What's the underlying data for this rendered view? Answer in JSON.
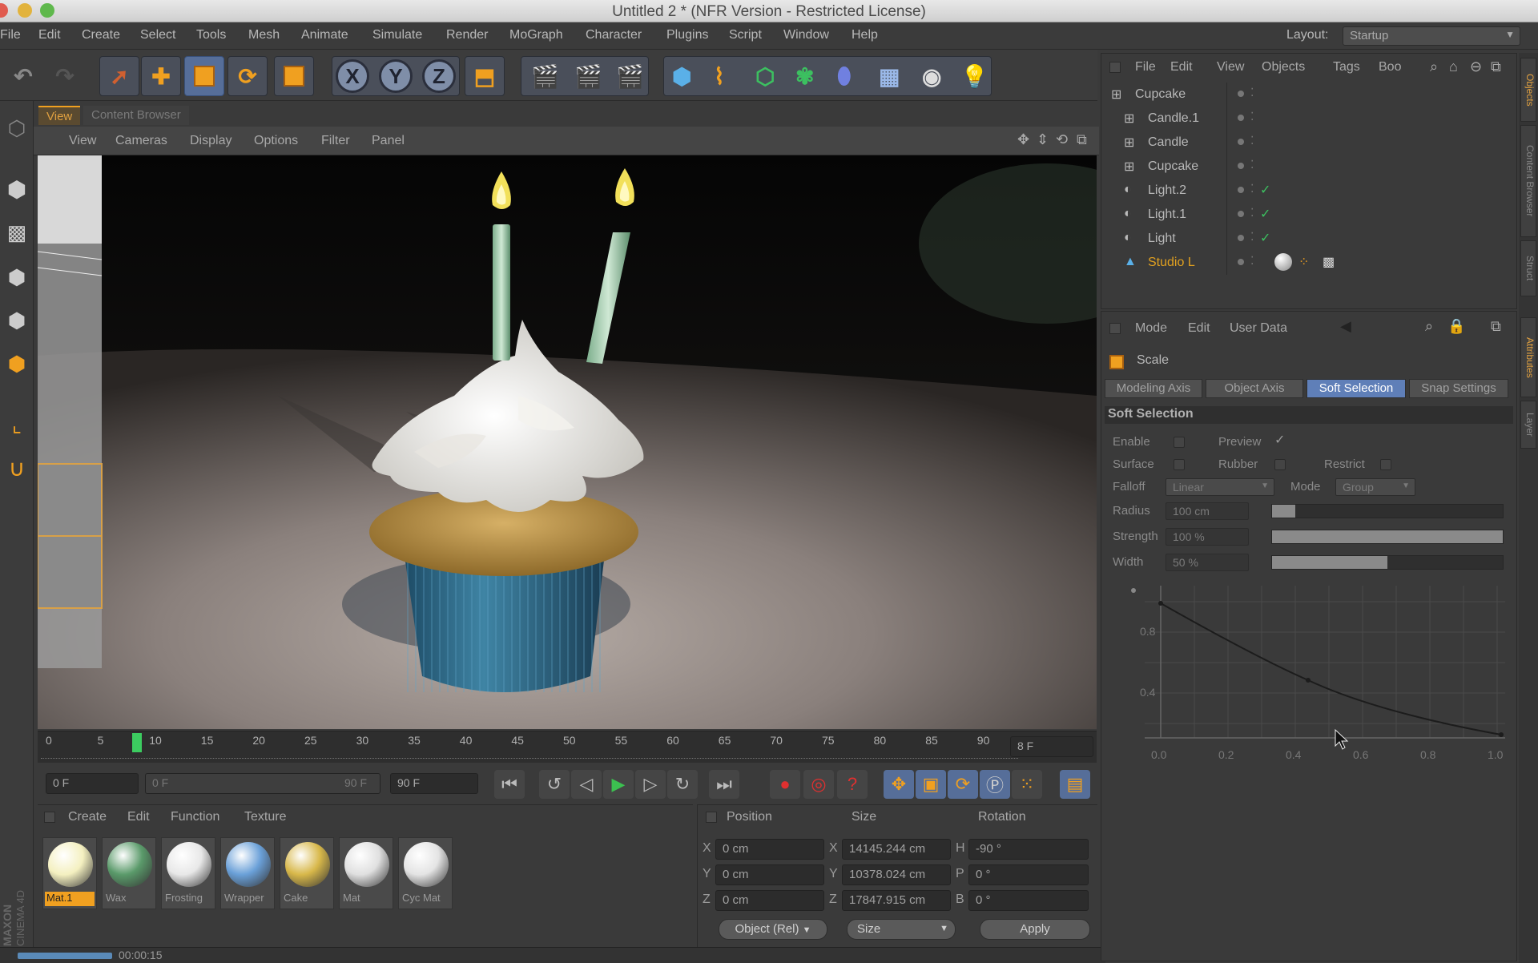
{
  "window": {
    "title": "Untitled 2 * (NFR Version - Restricted License)"
  },
  "menubar": {
    "items": [
      "File",
      "Edit",
      "Create",
      "Select",
      "Tools",
      "Mesh",
      "Animate",
      "Simulate",
      "Render",
      "MoGraph",
      "Character",
      "Plugins",
      "Script",
      "Window",
      "Help"
    ],
    "layout_label": "Layout:",
    "layout_value": "Startup"
  },
  "toolbar": {
    "axis_x": "X",
    "axis_y": "Y",
    "axis_z": "Z"
  },
  "viewport": {
    "tabs": [
      "View",
      "Content Browser"
    ],
    "menu": [
      "View",
      "Cameras",
      "Display",
      "Options",
      "Filter",
      "Panel"
    ]
  },
  "timeline": {
    "ticks": [
      "0",
      "5",
      "10",
      "15",
      "20",
      "25",
      "30",
      "35",
      "40",
      "45",
      "50",
      "55",
      "60",
      "65",
      "70",
      "75",
      "80",
      "85",
      "90"
    ],
    "current_frame": "8 F",
    "start_field": "0 F",
    "range_start": "0 F",
    "range_end": "90 F",
    "end_field": "90 F"
  },
  "materials": {
    "menu": [
      "Create",
      "Edit",
      "Function",
      "Texture"
    ],
    "items": [
      {
        "name": "Mat.1"
      },
      {
        "name": "Wax"
      },
      {
        "name": "Frosting"
      },
      {
        "name": "Wrapper"
      },
      {
        "name": "Cake"
      },
      {
        "name": "Mat"
      },
      {
        "name": "Cyc Mat"
      }
    ],
    "colors": [
      "#f4f0c0",
      "#5a9a6a",
      "#e8e8e8",
      "#6aa0d8",
      "#d8b84a",
      "#e0e0e0",
      "#e4e4e4"
    ]
  },
  "coordinates": {
    "headers": [
      "Position",
      "Size",
      "Rotation"
    ],
    "rows": [
      {
        "axis": "X",
        "pos": "0 cm",
        "size_axis": "X",
        "size": "14145.244 cm",
        "rot_axis": "H",
        "rot": "-90 °"
      },
      {
        "axis": "Y",
        "pos": "0 cm",
        "size_axis": "Y",
        "size": "10378.024 cm",
        "rot_axis": "P",
        "rot": "0 °"
      },
      {
        "axis": "Z",
        "pos": "0 cm",
        "size_axis": "Z",
        "size": "17847.915 cm",
        "rot_axis": "B",
        "rot": "0 °"
      }
    ],
    "mode_select": "Object (Rel)",
    "size_select": "Size",
    "apply": "Apply"
  },
  "status": {
    "time": "00:00:15"
  },
  "objects": {
    "menu": [
      "File",
      "Edit",
      "View",
      "Objects",
      "Tags",
      "Boo"
    ],
    "rows": [
      {
        "name": "Cupcake",
        "indent": 0,
        "check": false,
        "color": "#b8b8b8"
      },
      {
        "name": "Candle.1",
        "indent": 1,
        "check": false,
        "color": "#b8b8b8"
      },
      {
        "name": "Candle",
        "indent": 1,
        "check": false,
        "color": "#b8b8b8"
      },
      {
        "name": "Cupcake",
        "indent": 1,
        "check": false,
        "color": "#b8b8b8"
      },
      {
        "name": "Light.2",
        "indent": 1,
        "check": true,
        "color": "#b8b8b8"
      },
      {
        "name": "Light.1",
        "indent": 1,
        "check": true,
        "color": "#b8b8b8"
      },
      {
        "name": "Light",
        "indent": 1,
        "check": true,
        "color": "#b8b8b8"
      },
      {
        "name": "Studio L",
        "indent": 1,
        "check": false,
        "color": "#e0a020"
      }
    ]
  },
  "attributes": {
    "menu": [
      "Mode",
      "Edit",
      "User Data"
    ],
    "title": "Scale",
    "tabs": [
      "Modeling Axis",
      "Object Axis",
      "Soft Selection",
      "Snap Settings"
    ],
    "active_tab": "Soft Selection",
    "section": "Soft Selection",
    "enable": "Enable",
    "preview": "Preview",
    "surface": "Surface",
    "rubber": "Rubber",
    "restrict": "Restrict",
    "falloff_label": "Falloff",
    "falloff_value": "Linear",
    "mode_label": "Mode",
    "mode_value": "Group",
    "radius_label": "Radius",
    "radius_value": "100 cm",
    "strength_label": "Strength",
    "strength_value": "100 %",
    "width_label": "Width",
    "width_value": "50 %",
    "radius_fill": 0.1,
    "strength_fill": 1.0,
    "width_fill": 0.5,
    "graph_y": [
      "0.8",
      "0.4"
    ],
    "graph_x": [
      "0.0",
      "0.2",
      "0.4",
      "0.6",
      "0.8",
      "1.0"
    ]
  },
  "sidetabs": [
    "Objects",
    "Content Browser",
    "Struct",
    "Attributes",
    "Layer"
  ],
  "brand": "MAXON CINEMA 4D"
}
